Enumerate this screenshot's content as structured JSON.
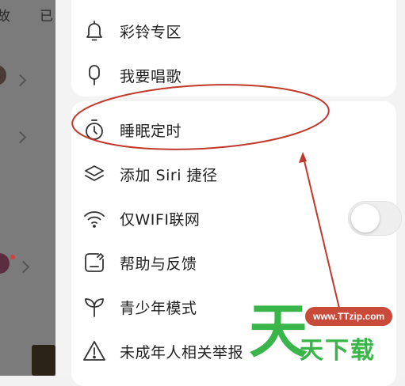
{
  "background_app": {
    "tab_left": "故",
    "tab_right": "已"
  },
  "menu_top": [
    {
      "label": "彩铃专区",
      "icon": "bell-icon"
    },
    {
      "label": "我要唱歌",
      "icon": "microphone-icon"
    }
  ],
  "menu_main": [
    {
      "label": "睡眠定时",
      "icon": "timer-icon"
    },
    {
      "label": "添加 Siri 捷径",
      "icon": "layers-icon"
    },
    {
      "label": "仅WIFI联网",
      "icon": "wifi-icon",
      "toggle": false
    },
    {
      "label": "帮助与反馈",
      "icon": "feedback-icon"
    },
    {
      "label": "青少年模式",
      "icon": "sprout-icon"
    },
    {
      "label": "未成年人相关举报",
      "icon": "warning-icon"
    }
  ],
  "colors": {
    "annotation_red": "#c0392b",
    "watermark_green": "#3ab54a",
    "watermark_pill": "#c94a38"
  },
  "watermark": {
    "big_char": "天",
    "url": "www.TTzip.com",
    "text": "天下载"
  }
}
